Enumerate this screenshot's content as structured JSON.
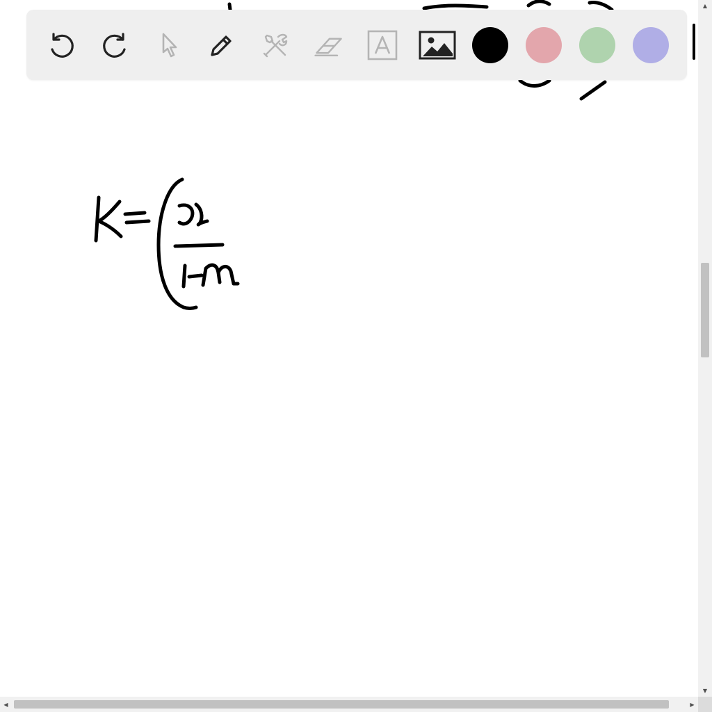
{
  "toolbar": {
    "tools": [
      {
        "name": "undo",
        "icon": "undo-icon",
        "state": "enabled"
      },
      {
        "name": "redo",
        "icon": "redo-icon",
        "state": "enabled"
      },
      {
        "name": "select",
        "icon": "pointer-icon",
        "state": "disabled"
      },
      {
        "name": "pen",
        "icon": "pencil-icon",
        "state": "enabled"
      },
      {
        "name": "tools",
        "icon": "tools-icon",
        "state": "disabled"
      },
      {
        "name": "eraser",
        "icon": "eraser-icon",
        "state": "disabled"
      },
      {
        "name": "text",
        "icon": "text-box-icon",
        "state": "disabled"
      },
      {
        "name": "image",
        "icon": "image-icon",
        "state": "enabled"
      }
    ],
    "colors": {
      "black": "#000000",
      "pink": "#e3a6ac",
      "green": "#afd3ae",
      "purple": "#b0aee6"
    },
    "selected_color": "black"
  },
  "canvas": {
    "handwriting": "K=(x/1-n",
    "ink_color": "#000000"
  }
}
